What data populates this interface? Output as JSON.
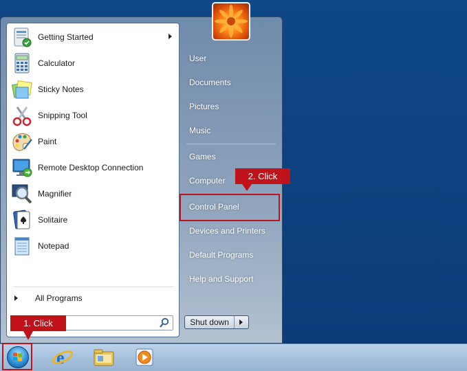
{
  "start_menu": {
    "programs": [
      {
        "label": "Getting Started",
        "icon": "getting-started-icon",
        "has_submenu": true
      },
      {
        "label": "Calculator",
        "icon": "calculator-icon"
      },
      {
        "label": "Sticky Notes",
        "icon": "sticky-notes-icon"
      },
      {
        "label": "Snipping Tool",
        "icon": "scissors-icon"
      },
      {
        "label": "Paint",
        "icon": "paint-palette-icon"
      },
      {
        "label": "Remote Desktop Connection",
        "icon": "remote-desktop-icon"
      },
      {
        "label": "Magnifier",
        "icon": "magnifier-icon"
      },
      {
        "label": "Solitaire",
        "icon": "playing-card-icon"
      },
      {
        "label": "Notepad",
        "icon": "notepad-icon"
      }
    ],
    "all_programs_label": "All Programs",
    "search": {
      "placeholder": "Search programs and files",
      "visible_text": "ams and files"
    },
    "right_items": [
      "User",
      "Documents",
      "Pictures",
      "Music",
      "Games",
      "Computer",
      "Control Panel",
      "Devices and Printers",
      "Default Programs",
      "Help and Support"
    ],
    "shutdown_label": "Shut down"
  },
  "annotations": {
    "step1": "1. Click",
    "step2": "2. Click"
  },
  "taskbar": {
    "pinned": [
      "internet-explorer-icon",
      "windows-explorer-icon",
      "media-player-icon"
    ]
  },
  "colors": {
    "annotation_red": "#c0121a",
    "desktop_blue": "#0d3f7f"
  }
}
